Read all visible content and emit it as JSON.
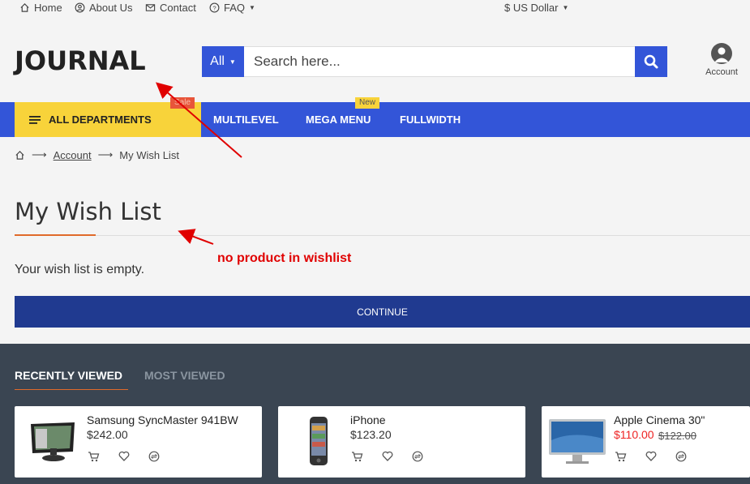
{
  "topbar": {
    "links": [
      {
        "label": "Home",
        "icon": "home-icon"
      },
      {
        "label": "About Us",
        "icon": "user-circle-icon"
      },
      {
        "label": "Contact",
        "icon": "mail-icon"
      },
      {
        "label": "FAQ",
        "icon": "question-circle-icon"
      }
    ],
    "currency": "$ US Dollar"
  },
  "header": {
    "logo": "JOURNAL",
    "search": {
      "category": "All",
      "placeholder": "Search here..."
    },
    "account_label": "Account"
  },
  "nav": {
    "all_departments": "ALL DEPARTMENTS",
    "items": [
      {
        "label": "MULTILEVEL",
        "badge": ""
      },
      {
        "label": "MEGA MENU",
        "badge": "New"
      },
      {
        "label": "FULLWIDTH",
        "badge": ""
      }
    ],
    "sale_badge": "Sale"
  },
  "breadcrumb": {
    "items": [
      "Account",
      "My Wish List"
    ]
  },
  "main": {
    "title": "My Wish List",
    "empty_message": "Your wish list is empty.",
    "annotation": "no product in wishlist",
    "continue_label": "CONTINUE"
  },
  "recent": {
    "tabs": [
      "RECENTLY VIEWED",
      "MOST VIEWED"
    ],
    "products": [
      {
        "name": "Samsung SyncMaster 941BW",
        "price": "$242.00",
        "old_price": ""
      },
      {
        "name": "iPhone",
        "price": "$123.20",
        "old_price": ""
      },
      {
        "name": "Apple Cinema 30\"",
        "price": "$110.00",
        "old_price": "$122.00"
      }
    ]
  },
  "colors": {
    "brand_blue": "#3355d8",
    "dark_blue": "#203a90",
    "yellow": "#f8d33a",
    "annotation_red": "#e00000",
    "accent_orange": "#e06a2a"
  }
}
